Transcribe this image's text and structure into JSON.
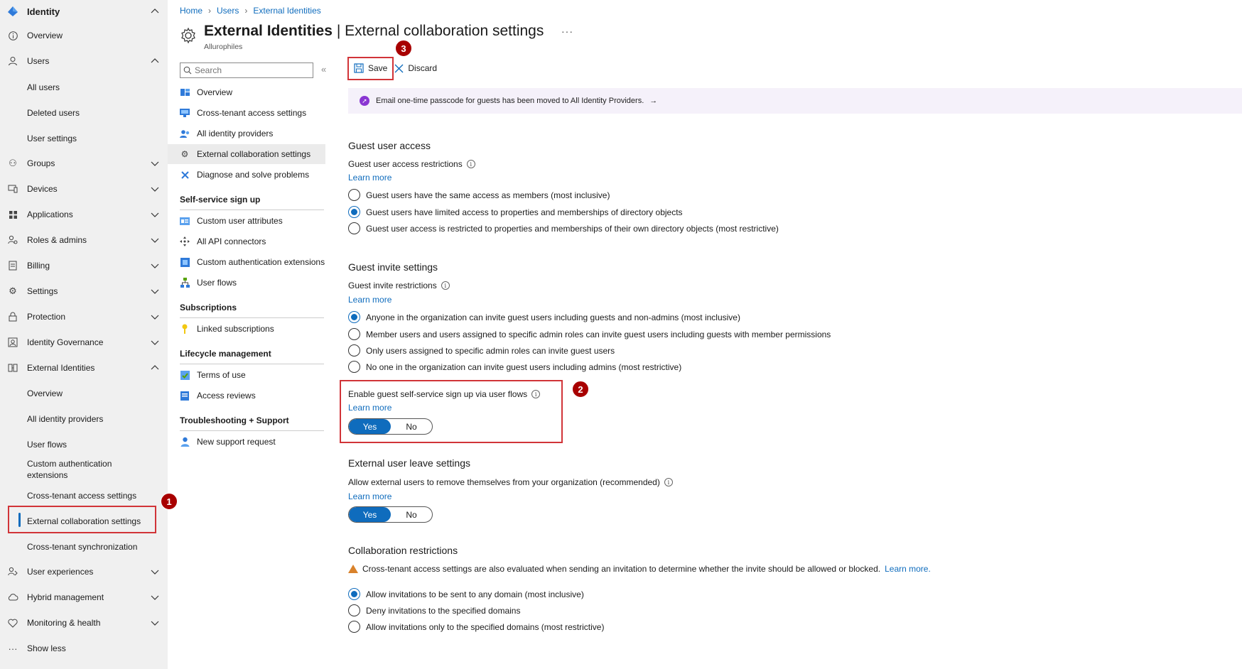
{
  "nav": {
    "title": "Identity",
    "items": [
      {
        "label": "Overview",
        "icon": "info-icon"
      },
      {
        "label": "Users",
        "icon": "user-icon"
      },
      {
        "label": "All users"
      },
      {
        "label": "Deleted users"
      },
      {
        "label": "User settings"
      },
      {
        "label": "Groups",
        "icon": "groups-icon"
      },
      {
        "label": "Devices",
        "icon": "devices-icon"
      },
      {
        "label": "Applications",
        "icon": "apps-icon"
      },
      {
        "label": "Roles & admins",
        "icon": "roles-icon"
      },
      {
        "label": "Billing",
        "icon": "billing-icon"
      },
      {
        "label": "Settings",
        "icon": "gear-icon"
      },
      {
        "label": "Protection",
        "icon": "lock-icon"
      },
      {
        "label": "Identity Governance",
        "icon": "governance-icon"
      },
      {
        "label": "External Identities",
        "icon": "external-icon"
      },
      {
        "label": "Overview"
      },
      {
        "label": "All identity providers"
      },
      {
        "label": "User flows"
      },
      {
        "label": "Custom authentication extensions"
      },
      {
        "label": "Cross-tenant access settings"
      },
      {
        "label": "External collaboration settings"
      },
      {
        "label": "Cross-tenant synchronization"
      },
      {
        "label": "User experiences",
        "icon": "experiences-icon"
      },
      {
        "label": "Hybrid management",
        "icon": "cloud-icon"
      },
      {
        "label": "Monitoring & health",
        "icon": "heart-icon"
      },
      {
        "label": "Show less",
        "icon": "ellipsis-icon"
      }
    ]
  },
  "breadcrumb": [
    "Home",
    "Users",
    "External Identities"
  ],
  "page": {
    "title_bold": "External Identities",
    "title_rest": "| External collaboration settings",
    "subtitle": "Allurophiles",
    "more": "···"
  },
  "menu": {
    "search_placeholder": "Search",
    "collapse": "«",
    "items": [
      "Overview",
      "Cross-tenant access settings",
      "All identity providers",
      "External collaboration settings",
      "Diagnose and solve problems"
    ],
    "sections": [
      {
        "title": "Self-service sign up",
        "items": [
          "Custom user attributes",
          "All API connectors",
          "Custom authentication extensions",
          "User flows"
        ]
      },
      {
        "title": "Subscriptions",
        "items": [
          "Linked subscriptions"
        ]
      },
      {
        "title": "Lifecycle management",
        "items": [
          "Terms of use",
          "Access reviews"
        ]
      },
      {
        "title": "Troubleshooting + Support",
        "items": [
          "New support request"
        ]
      }
    ]
  },
  "toolbar": {
    "save": "Save",
    "discard": "Discard"
  },
  "banner": {
    "text": "Email one-time passcode for guests has been moved to All Identity Providers.",
    "arrow": "→"
  },
  "guest_access": {
    "heading": "Guest user access",
    "label": "Guest user access restrictions",
    "learn": "Learn more",
    "options": [
      "Guest users have the same access as members (most inclusive)",
      "Guest users have limited access to properties and memberships of directory objects",
      "Guest user access is restricted to properties and memberships of their own directory objects (most restrictive)"
    ],
    "selected": 1
  },
  "guest_invite": {
    "heading": "Guest invite settings",
    "label": "Guest invite restrictions",
    "learn": "Learn more",
    "options": [
      "Anyone in the organization can invite guest users including guests and non-admins (most inclusive)",
      "Member users and users assigned to specific admin roles can invite guest users including guests with member permissions",
      "Only users assigned to specific admin roles can invite guest users",
      "No one in the organization can invite guest users including admins (most restrictive)"
    ],
    "selected": 0
  },
  "self_service": {
    "label": "Enable guest self-service sign up via user flows",
    "learn": "Learn more",
    "yes": "Yes",
    "no": "No",
    "value": "Yes"
  },
  "leave": {
    "heading": "External user leave settings",
    "label": "Allow external users to remove themselves from your organization (recommended)",
    "learn": "Learn more",
    "yes": "Yes",
    "no": "No",
    "value": "Yes"
  },
  "collab": {
    "heading": "Collaboration restrictions",
    "warning": "Cross-tenant access settings are also evaluated when sending an invitation to determine whether the invite should be allowed or blocked.",
    "warning_link": "Learn more.",
    "options": [
      "Allow invitations to be sent to any domain (most inclusive)",
      "Deny invitations to the specified domains",
      "Allow invitations only to the specified domains (most restrictive)"
    ],
    "selected": 0
  },
  "badges": [
    "1",
    "2",
    "3"
  ],
  "colors": {
    "accent": "#0f6cbd",
    "highlight": "#d13438",
    "badge": "#a80000"
  }
}
